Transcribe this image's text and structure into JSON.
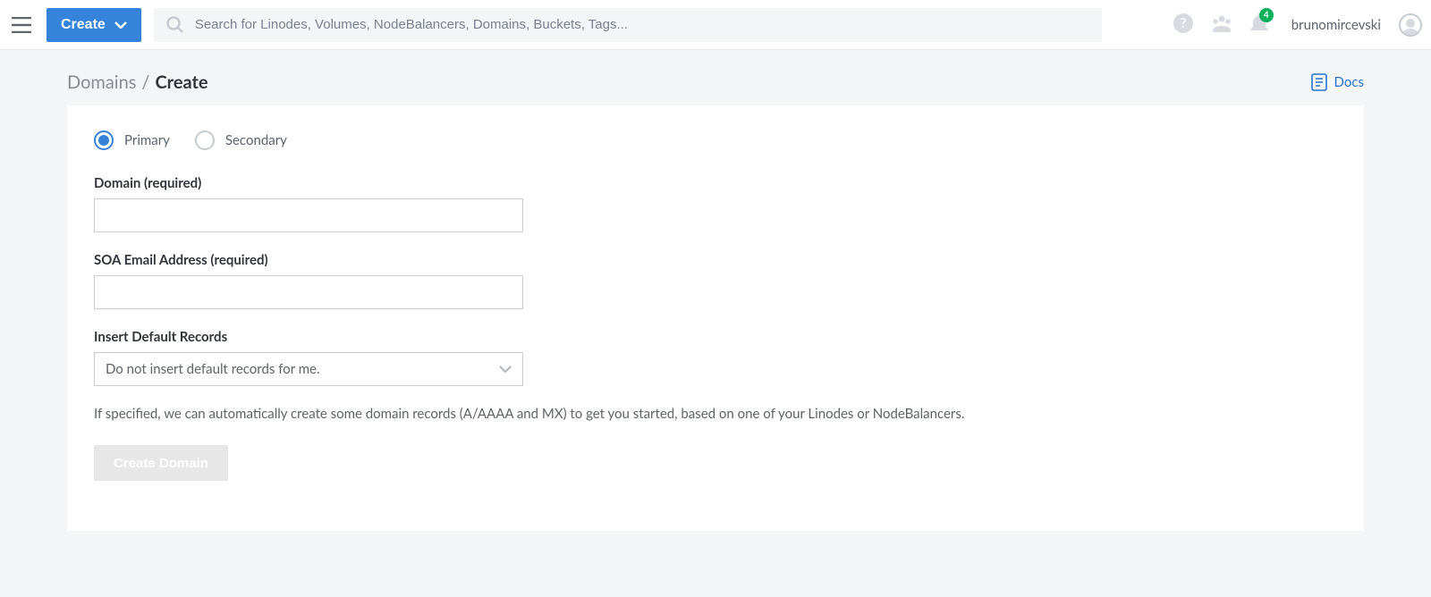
{
  "topbar": {
    "create_label": "Create",
    "search_placeholder": "Search for Linodes, Volumes, NodeBalancers, Domains, Buckets, Tags...",
    "notification_count": "4",
    "username": "brunomircevski"
  },
  "breadcrumb": {
    "parent": "Domains",
    "current": "Create"
  },
  "docs_label": "Docs",
  "form": {
    "radio_primary": "Primary",
    "radio_secondary": "Secondary",
    "domain_label": "Domain (required)",
    "domain_value": "",
    "soa_label": "SOA Email Address (required)",
    "soa_value": "",
    "default_records_label": "Insert Default Records",
    "default_records_selected": "Do not insert default records for me.",
    "helper_text": "If specified, we can automatically create some domain records (A/AAAA and MX) to get you started, based on one of your Linodes or NodeBalancers.",
    "submit_label": "Create Domain"
  }
}
